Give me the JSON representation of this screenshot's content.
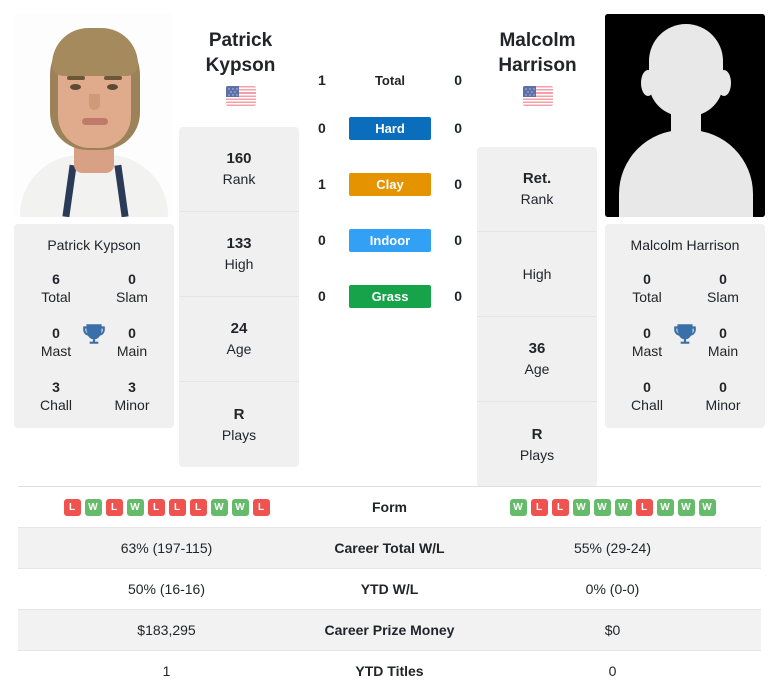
{
  "accent_colors": {
    "hard": "#0a6ebd",
    "clay": "#e59400",
    "indoor": "#32a0f5",
    "grass": "#16a34a",
    "win_badge": "#66bb6a",
    "loss_badge": "#ef5350",
    "trophy": "#3b6fa8",
    "card_bg": "#f0f0f0",
    "row_shade": "#f2f2f2"
  },
  "players": {
    "left": {
      "photo": "player-photo",
      "first_name": "Patrick",
      "last_name": "Kypson",
      "flag": "us-flag-icon",
      "rank": [
        {
          "value": "160",
          "label": "Rank"
        },
        {
          "value": "133",
          "label": "High"
        },
        {
          "value": "24",
          "label": "Age"
        },
        {
          "value": "R",
          "label": "Plays"
        }
      ],
      "titles": {
        "name": "Patrick Kypson",
        "total": "6",
        "slam": "0",
        "mast": "0",
        "main": "0",
        "chall": "3",
        "minor": "3",
        "trophy_icon": "trophy-icon"
      },
      "form": [
        "L",
        "W",
        "L",
        "W",
        "L",
        "L",
        "L",
        "W",
        "W",
        "L"
      ]
    },
    "right": {
      "photo": "player-photo-placeholder",
      "first_name": "Malcolm",
      "last_name": "Harrison",
      "flag": "us-flag-icon",
      "rank": [
        {
          "value": "Ret.",
          "label": "Rank"
        },
        {
          "value": "",
          "label": "High"
        },
        {
          "value": "36",
          "label": "Age"
        },
        {
          "value": "R",
          "label": "Plays"
        }
      ],
      "titles": {
        "name": "Malcolm Harrison",
        "total": "0",
        "slam": "0",
        "mast": "0",
        "main": "0",
        "chall": "0",
        "minor": "0",
        "trophy_icon": "trophy-icon"
      },
      "form": [
        "W",
        "L",
        "L",
        "W",
        "W",
        "W",
        "L",
        "W",
        "W",
        "W"
      ]
    }
  },
  "stat_labels": {
    "total": "Total",
    "slam": "Slam",
    "mast": "Mast",
    "main": "Main",
    "chall": "Chall",
    "minor": "Minor"
  },
  "h2h": {
    "total": {
      "label": "Total",
      "left": "1",
      "right": "0"
    },
    "surfaces": [
      {
        "label": "Hard",
        "left": "0",
        "right": "0",
        "color": "#0a6ebd"
      },
      {
        "label": "Clay",
        "left": "1",
        "right": "0",
        "color": "#e59400"
      },
      {
        "label": "Indoor",
        "left": "0",
        "right": "0",
        "color": "#32a0f5"
      },
      {
        "label": "Grass",
        "left": "0",
        "right": "0",
        "color": "#16a34a"
      }
    ]
  },
  "comparison_rows": [
    {
      "label": "Form",
      "left": "",
      "right": "",
      "type": "form",
      "shaded": false
    },
    {
      "label": "Career Total W/L",
      "left": "63% (197-115)",
      "right": "55% (29-24)",
      "type": "text",
      "shaded": true
    },
    {
      "label": "YTD W/L",
      "left": "50% (16-16)",
      "right": "0% (0-0)",
      "type": "text",
      "shaded": false
    },
    {
      "label": "Career Prize Money",
      "left": "$183,295",
      "right": "$0",
      "type": "text",
      "shaded": true
    },
    {
      "label": "YTD Titles",
      "left": "1",
      "right": "0",
      "type": "text",
      "shaded": false
    }
  ]
}
